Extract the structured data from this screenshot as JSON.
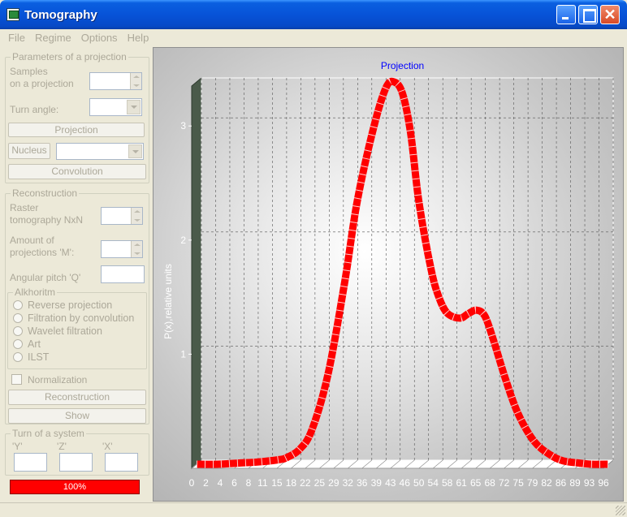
{
  "window": {
    "title": "Tomography"
  },
  "menu": [
    "File",
    "Regime",
    "Options",
    "Help"
  ],
  "params": {
    "legend": "Parameters of a projection",
    "samples_label_1": "Samples",
    "samples_label_2": "on a projection",
    "turn_angle_label": "Turn angle:",
    "projection_button": "Projection",
    "nucleus_button": "Nucleus",
    "convolution_button": "Convolution"
  },
  "recon": {
    "legend": "Reconstruction",
    "raster_label_1": "Raster",
    "raster_label_2": "tomography NxN",
    "amount_label_1": "Amount of",
    "amount_label_2": "projections 'M':",
    "angular_label": "Angular pitch 'Q'",
    "algorithm_legend": "Alkhoritm",
    "algorithms": [
      "Reverse projection",
      "Filtration by convolution",
      "Wavelet filtration",
      "Art",
      "ILST"
    ],
    "normalization_label": "Normalization",
    "reconstruction_button": "Reconstruction",
    "show_button": "Show"
  },
  "turn": {
    "legend": "Turn of a system",
    "y_label": "'Y'",
    "z_label": "'Z'",
    "x_label": "'X'"
  },
  "progress": {
    "value": 1.0,
    "text": "100%"
  },
  "colors": {
    "curve": "#ff0000",
    "title_bar": "#0753d8",
    "chart_title": "#0000ff"
  },
  "chart_data": {
    "type": "line",
    "title": "Projection",
    "ylabel": "P(x),relative units",
    "xlabel": "",
    "ylim": [
      0,
      3.35
    ],
    "yticks": [
      "1",
      "2",
      "3"
    ],
    "xticks": [
      "0",
      "2",
      "4",
      "6",
      "8",
      "11",
      "15",
      "18",
      "22",
      "25",
      "29",
      "32",
      "36",
      "39",
      "43",
      "46",
      "50",
      "54",
      "58",
      "61",
      "65",
      "68",
      "72",
      "75",
      "79",
      "82",
      "86",
      "89",
      "93",
      "96"
    ],
    "grid": true,
    "series": [
      {
        "x": [
          0,
          5,
          10,
          15,
          20,
          22,
          25,
          28,
          32,
          36,
          39,
          43,
          46,
          48,
          50,
          52,
          54,
          57,
          59,
          61,
          64,
          66,
          68,
          70,
          72,
          75,
          78,
          82,
          86,
          89,
          93,
          96,
          100
        ],
        "y": [
          0.0,
          0.0,
          0.01,
          0.02,
          0.04,
          0.06,
          0.13,
          0.3,
          0.8,
          1.6,
          2.3,
          2.95,
          3.3,
          3.35,
          3.25,
          2.9,
          2.3,
          1.7,
          1.45,
          1.32,
          1.28,
          1.32,
          1.35,
          1.3,
          1.1,
          0.75,
          0.45,
          0.2,
          0.08,
          0.03,
          0.01,
          0.0,
          0.0
        ]
      }
    ]
  }
}
